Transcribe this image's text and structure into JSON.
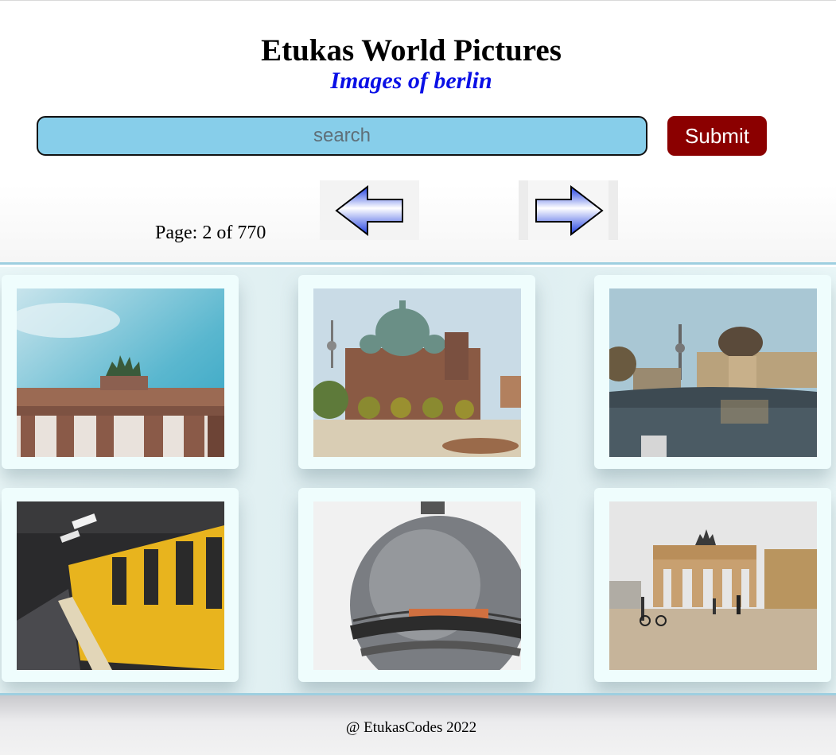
{
  "header": {
    "title": "Etukas World Pictures",
    "subtitle": "Images of berlin"
  },
  "search": {
    "placeholder": "search",
    "value": "",
    "submit_label": "Submit"
  },
  "pagination": {
    "page_text": "Page: 2 of 770",
    "current_page": 2,
    "total_pages": 770,
    "prev_icon": "left-arrow-icon",
    "next_icon": "right-arrow-icon"
  },
  "gallery": {
    "images": [
      {
        "subject": "brandenburg-gate-quadriga-photo"
      },
      {
        "subject": "berlin-cathedral-photo"
      },
      {
        "subject": "bode-museum-river-photo"
      },
      {
        "subject": "u-bahn-yellow-train-photo"
      },
      {
        "subject": "tv-tower-sphere-photo"
      },
      {
        "subject": "brandenburg-gate-square-photo"
      }
    ]
  },
  "footer": {
    "copyright": "@ EtukasCodes 2022"
  },
  "colors": {
    "subtitle": "#0a10e6",
    "search_bg": "#87ceea",
    "submit_bg": "#8b0000",
    "arrow_fill": "#2255ee",
    "divider": "#9ecfe0"
  }
}
